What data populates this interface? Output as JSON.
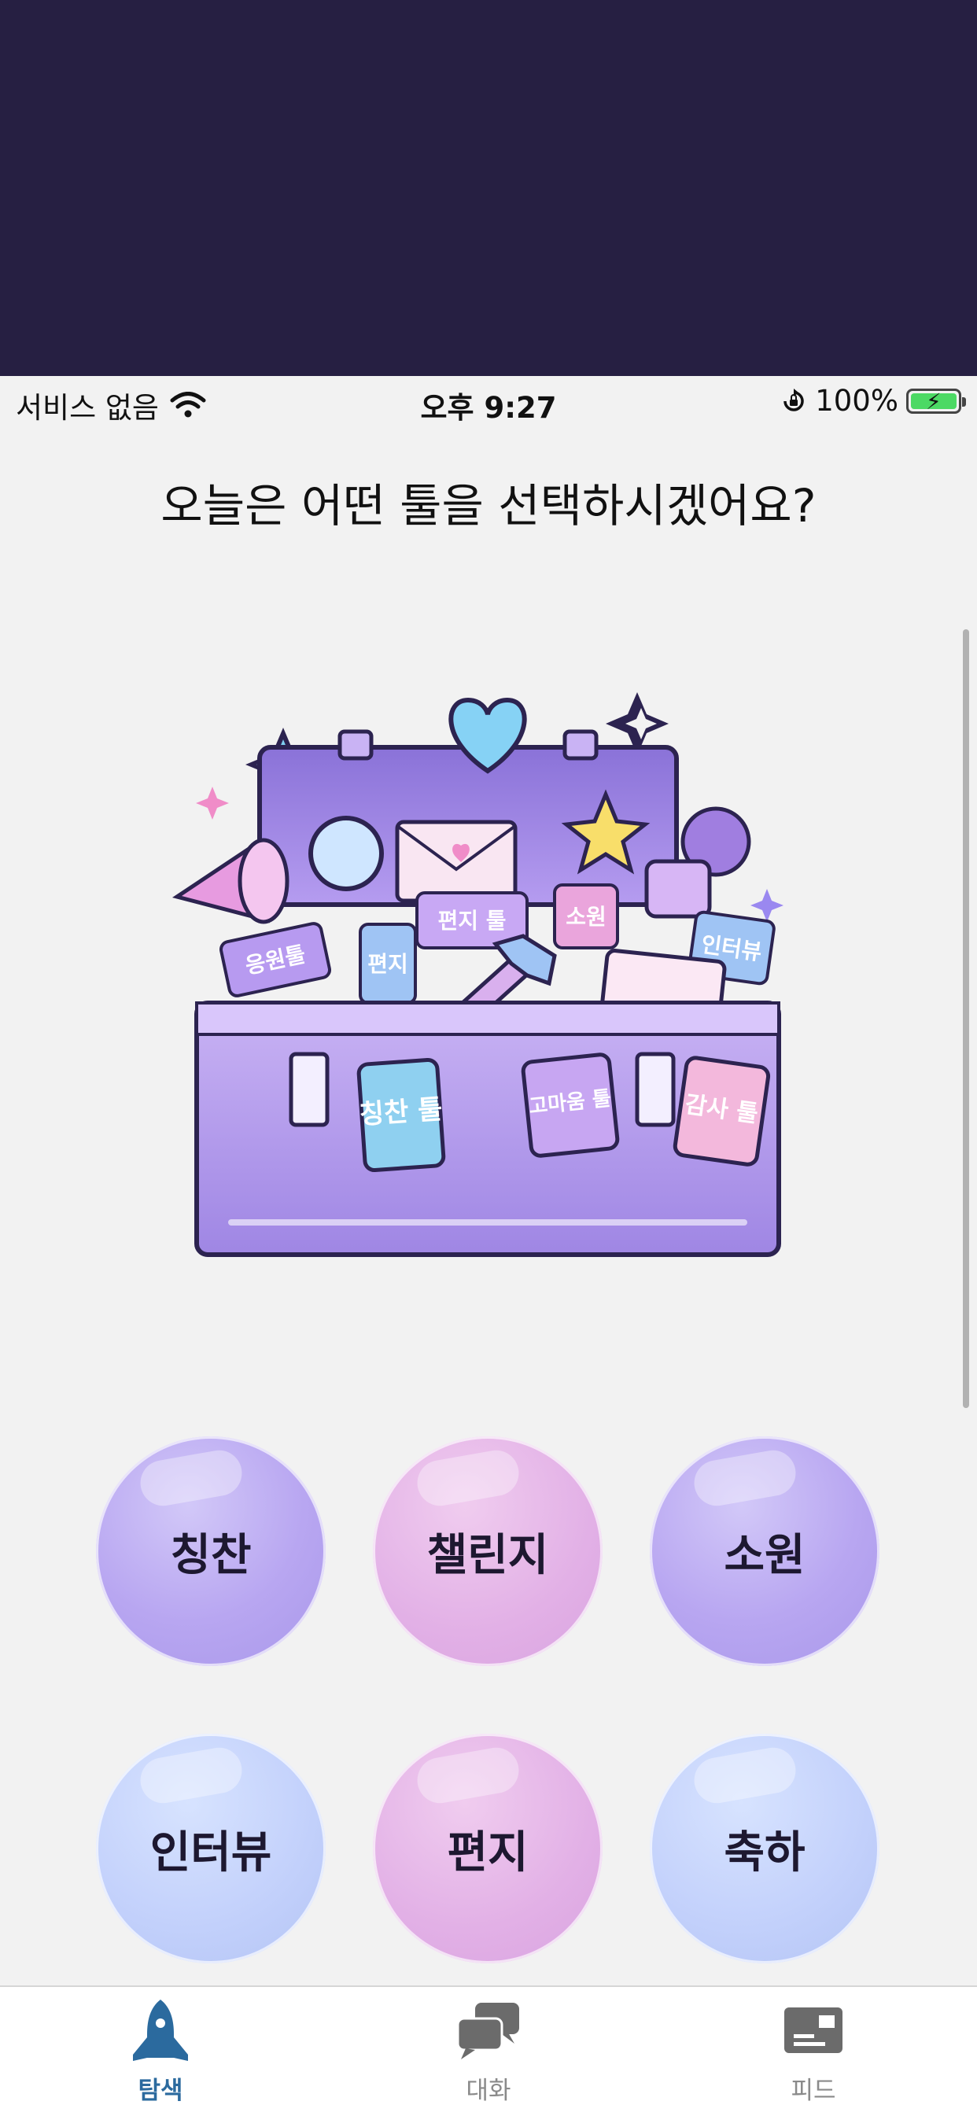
{
  "status": {
    "carrier": "서비스 없음",
    "time": "오후 9:27",
    "battery_percent": "100%"
  },
  "heading": "오늘은 어떤 툴을 선택하시겠어요?",
  "hero_labels": {
    "cheer": "응원툴",
    "letter_small": "편지",
    "letter": "편지 툴",
    "wish": "소원",
    "interview": "인터뷰",
    "praise": "칭찬 툴",
    "thanks_word": "고마움 툴",
    "gratitude": "감사 툴"
  },
  "tools": [
    "칭찬",
    "챌린지",
    "소원",
    "인터뷰",
    "편지",
    "축하"
  ],
  "tabs": [
    {
      "label": "탐색",
      "icon": "rocket-icon",
      "active": true
    },
    {
      "label": "대화",
      "icon": "chat-bubbles-icon",
      "active": false
    },
    {
      "label": "피드",
      "icon": "feed-card-icon",
      "active": false
    }
  ],
  "colors": {
    "top_band": "#261f42",
    "active_tab": "#2b6a9e",
    "battery_fill": "#4cd964"
  }
}
